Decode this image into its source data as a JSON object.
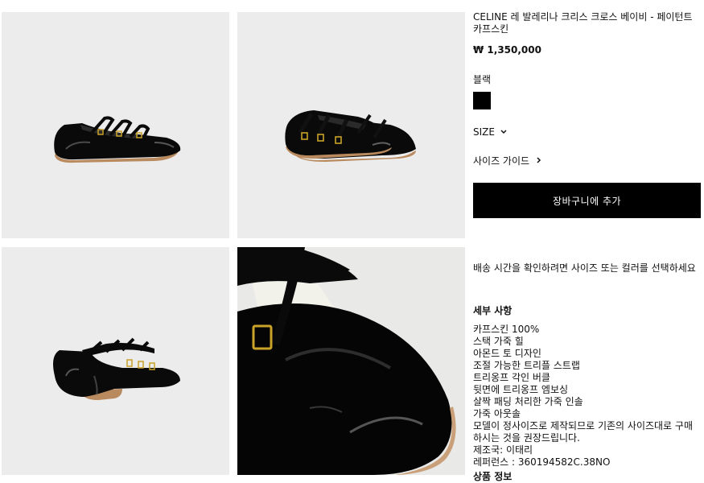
{
  "product": {
    "title": "CELINE 레 발레리나 크리스 크로스 베이비 - 페이턴트 카프스킨",
    "price": "₩ 1,350,000",
    "color_label": "블랙",
    "color_swatch": "#000000",
    "size_label": "SIZE",
    "size_guide_label": "사이즈 가이드",
    "add_to_cart_label": "장바구니에 추가",
    "shipping_note": "배송 시간을 확인하려면 사이즈 또는 컬러를 선택하세요",
    "details_heading": "세부 사항",
    "details": [
      "카프스킨 100%",
      "스택 가죽 힐",
      "아몬드 토 디자인",
      "조절 가능한 트리플 스트랩",
      "트리옹프 각인 버클",
      "뒷면에 트리옹프 엠보싱",
      "살짝 패딩 처리한 가죽 인솔",
      "가죽 아웃솔",
      "모델이 정사이즈로 제작되므로 기존의 사이즈대로 구매하시는 것을 권장드립니다.",
      "제조국: 이태리",
      "레퍼런스 : 360194582C.38NO"
    ],
    "product_info_label": "상품 정보"
  },
  "gallery": {
    "images": [
      "shoe-side-view",
      "shoe-pair-angle-view",
      "shoe-pair-back-view",
      "shoe-toe-closeup"
    ]
  }
}
